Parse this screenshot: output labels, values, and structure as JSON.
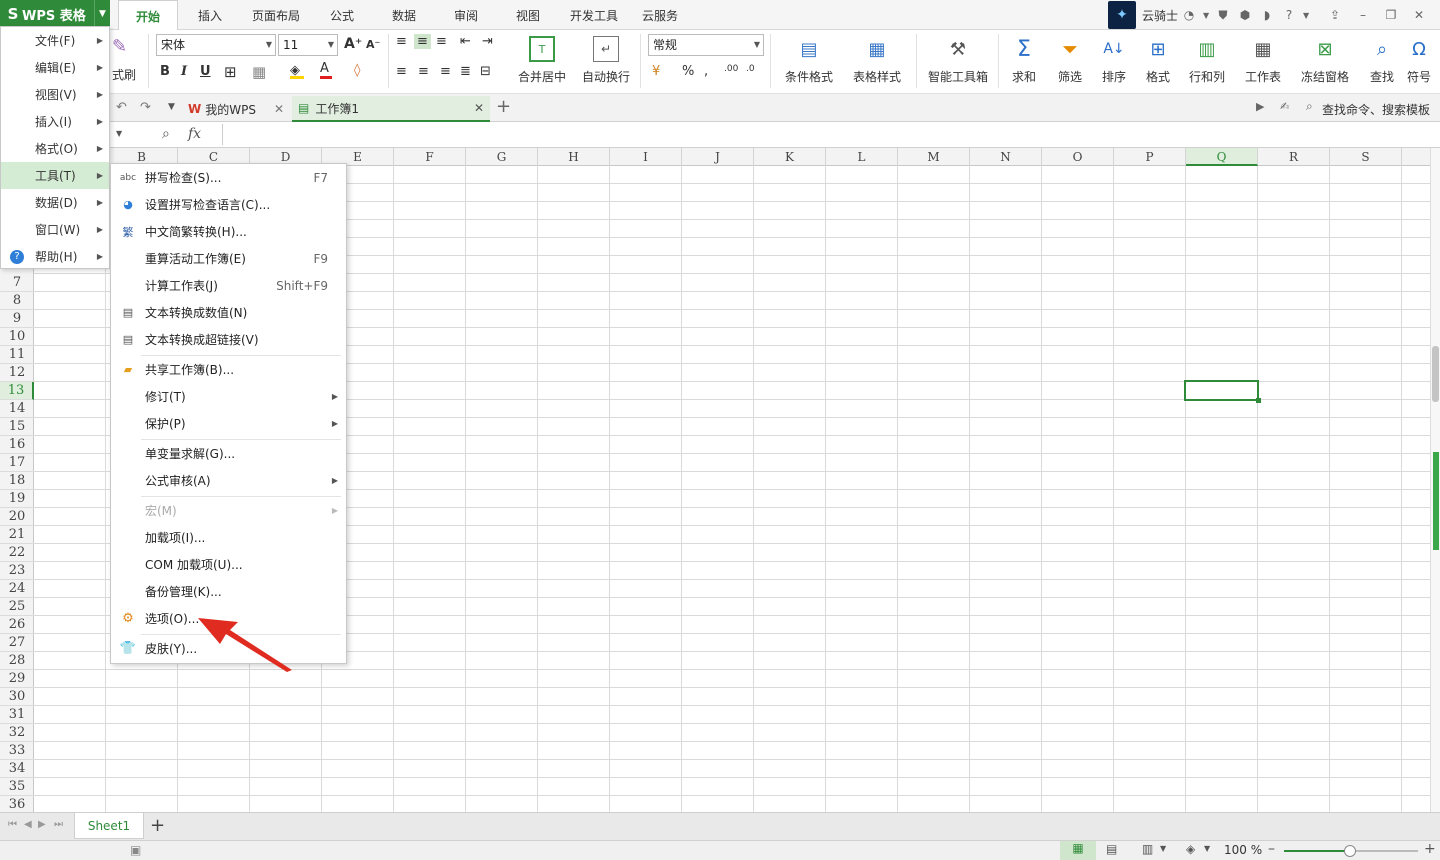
{
  "app": {
    "brand": "WPS 表格"
  },
  "ribbon_tabs": [
    "开始",
    "插入",
    "页面布局",
    "公式",
    "数据",
    "审阅",
    "视图",
    "开发工具",
    "云服务"
  ],
  "user": {
    "name": "云骑士"
  },
  "ribbon": {
    "font_name": "宋体",
    "font_size": "11",
    "format_painter_label": "式刷",
    "number_format": "常规",
    "merge_center_label": "合并居中",
    "wrap_label": "自动换行",
    "cond_format_label": "条件格式",
    "table_style_label": "表格样式",
    "smart_toolbox_label": "智能工具箱",
    "sum_label": "求和",
    "filter_label": "筛选",
    "sort_label": "排序",
    "format_label": "格式",
    "rowcol_label": "行和列",
    "sheet_label": "工作表",
    "freeze_label": "冻结窗格",
    "find_label": "查找",
    "symbol_label": "符号"
  },
  "doc_tabs": {
    "my_wps": "我的WPS",
    "workbook": "工作簿1",
    "search": "查找命令、搜索模板"
  },
  "formula_bar": {
    "fx": "fx"
  },
  "columns": [
    "B",
    "C",
    "D",
    "E",
    "F",
    "G",
    "H",
    "I",
    "J",
    "K",
    "L",
    "M",
    "N",
    "O",
    "P",
    "Q",
    "R",
    "S"
  ],
  "rows": [
    "7",
    "8",
    "9",
    "10",
    "11",
    "12",
    "13",
    "14",
    "15",
    "16",
    "17",
    "18",
    "19",
    "20",
    "21",
    "22",
    "23",
    "24",
    "25",
    "26",
    "27",
    "28",
    "29",
    "30",
    "31",
    "32",
    "33",
    "34",
    "35",
    "36"
  ],
  "main_menu": [
    {
      "label": "文件(F)"
    },
    {
      "label": "编辑(E)"
    },
    {
      "label": "视图(V)"
    },
    {
      "label": "插入(I)"
    },
    {
      "label": "格式(O)"
    },
    {
      "label": "工具(T)"
    },
    {
      "label": "数据(D)"
    },
    {
      "label": "窗口(W)"
    },
    {
      "label": "帮助(H)"
    }
  ],
  "tools_menu": [
    {
      "label": "拼写检查(S)...",
      "key": "F7"
    },
    {
      "label": "设置拼写检查语言(C)...",
      "key": ""
    },
    {
      "label": "中文简繁转换(H)...",
      "key": ""
    },
    {
      "label": "重算活动工作簿(E)",
      "key": "F9"
    },
    {
      "label": "计算工作表(J)",
      "key": "Shift+F9"
    },
    {
      "label": "文本转换成数值(N)",
      "key": ""
    },
    {
      "label": "文本转换成超链接(V)",
      "key": ""
    },
    {
      "label": "共享工作簿(B)...",
      "key": ""
    },
    {
      "label": "修订(T)",
      "key": ""
    },
    {
      "label": "保护(P)",
      "key": ""
    },
    {
      "label": "单变量求解(G)...",
      "key": ""
    },
    {
      "label": "公式审核(A)",
      "key": ""
    },
    {
      "label": "宏(M)",
      "key": ""
    },
    {
      "label": "加载项(I)...",
      "key": ""
    },
    {
      "label": "COM 加载项(U)...",
      "key": ""
    },
    {
      "label": "备份管理(K)...",
      "key": ""
    },
    {
      "label": "选项(O)...",
      "key": ""
    },
    {
      "label": "皮肤(Y)...",
      "key": ""
    }
  ],
  "sheet_tab": "Sheet1",
  "status": {
    "zoom": "100 %"
  },
  "colors": {
    "accent": "#2f8b3a",
    "arrow": "#e02b20",
    "highlight": "#d5ecd4"
  }
}
